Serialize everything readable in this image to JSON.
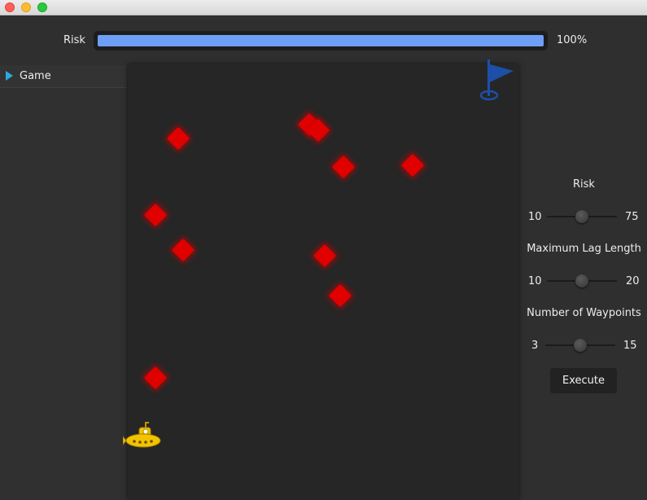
{
  "risk_bar": {
    "label": "Risk",
    "percent_text": "100%",
    "fill_fraction": 1.0
  },
  "sidebar": {
    "items": [
      {
        "label": "Game"
      }
    ]
  },
  "controls": {
    "risk": {
      "title": "Risk",
      "min": "10",
      "max": "75",
      "value_fraction": 0.5
    },
    "lag": {
      "title": "Maximum Lag Length",
      "min": "10",
      "max": "20",
      "value_fraction": 0.5
    },
    "waypoints": {
      "title": "Number of Waypoints",
      "min": "3",
      "max": "15",
      "value_fraction": 0.5
    },
    "execute_label": "Execute"
  },
  "colors": {
    "risk_fill": "#6e9ff7",
    "obstacle": "#e00000",
    "flag": "#1d4fa8",
    "submarine": "#f2c400"
  },
  "icons": {
    "goal": "blue-flag-icon",
    "player": "yellow-submarine-icon",
    "obstacle": "red-diamond-obstacle"
  }
}
